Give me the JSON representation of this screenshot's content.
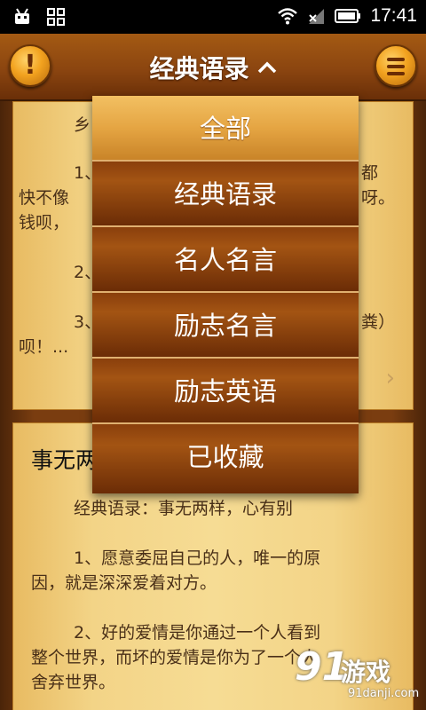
{
  "status_bar": {
    "time": "17:41",
    "icons": [
      "android-debug-icon",
      "qr-grid-icon",
      "wifi-icon",
      "no-signal-icon",
      "battery-icon"
    ]
  },
  "header": {
    "title": "经典语录",
    "left_icon": "exclamation-icon",
    "right_icon": "menu-icon"
  },
  "card1": {
    "lines": [
      "乡",
      "1、",
      "都",
      "快不像",
      "呀。",
      "钱呗，",
      "2、",
      "3、",
      "粪）",
      "呗！..."
    ]
  },
  "card2": {
    "title": "事无两",
    "subtitle": "经典语录：事无两样，心有别",
    "p1_line1": "1、愿意委屈自己的人，唯一的原",
    "p1_line2": "因，就是深深爱着对方。",
    "p2_line1": "2、好的爱情是你通过一个人看到",
    "p2_line2": "整个世界，而坏的爱情是你为了一个人",
    "p2_line3": "舍弃世界。"
  },
  "dropdown": {
    "items": [
      {
        "label": "全部",
        "selected": true
      },
      {
        "label": "经典语录",
        "selected": false
      },
      {
        "label": "名人名言",
        "selected": false
      },
      {
        "label": "励志名言",
        "selected": false
      },
      {
        "label": "励志英语",
        "selected": false
      },
      {
        "label": "已收藏",
        "selected": false
      }
    ]
  },
  "watermark": {
    "num": "91",
    "name": "游戏",
    "url": "91danji.com"
  },
  "colors": {
    "header_brown": "#8b4510",
    "card_paper": "#f6dc94",
    "dropdown_selected": "#e5a543",
    "dropdown_item": "#a35413"
  }
}
